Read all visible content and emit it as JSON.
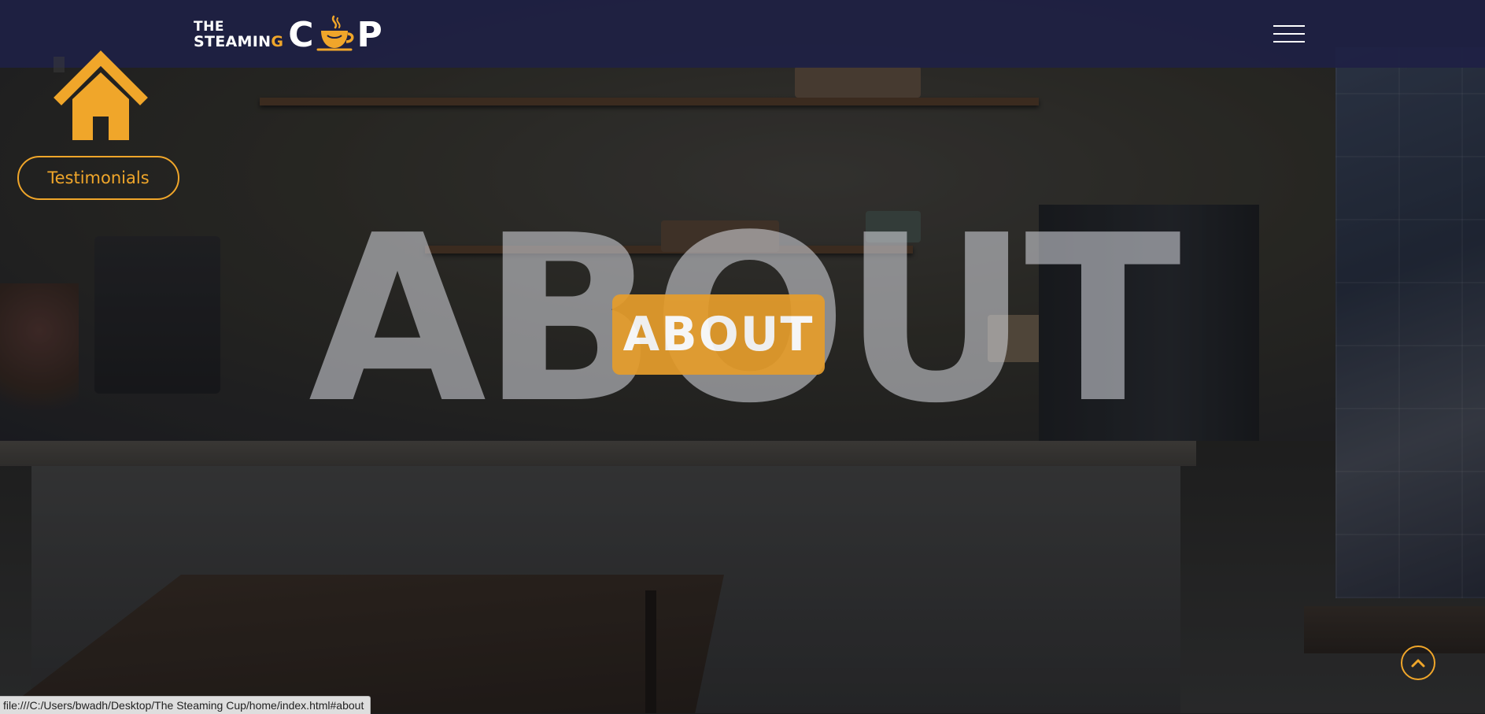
{
  "header": {
    "logo": {
      "line1": "THE",
      "line2_prefix": "STEAMIN",
      "line2_highlight": "G",
      "big_left": "C",
      "big_right": "P"
    },
    "menu_icon": "hamburger-menu-icon"
  },
  "sidebar": {
    "home_icon": "home-icon",
    "testimonials_label": "Testimonials"
  },
  "hero": {
    "background_text": "ABOUT",
    "badge_text": "ABOUT"
  },
  "scroll_top_icon": "chevron-up-icon",
  "status_bar": {
    "url": "file:///C:/Users/bwadh/Desktop/The Steaming Cup/home/index.html#about"
  },
  "colors": {
    "accent": "#f0a62a",
    "header_bg": "#1e2144"
  }
}
